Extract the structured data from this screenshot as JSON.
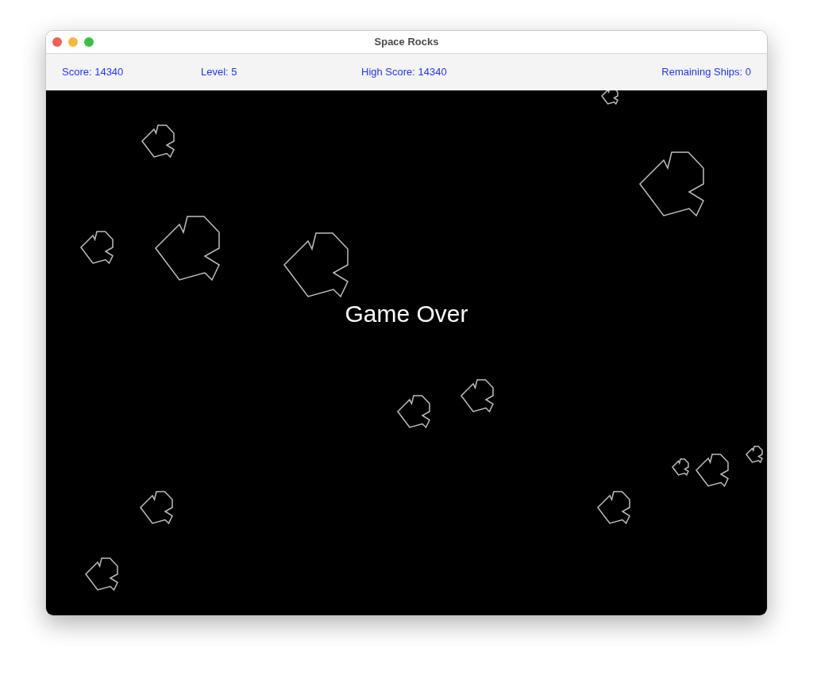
{
  "window": {
    "title": "Space Rocks"
  },
  "stats": [
    {
      "text": "Score: 14340"
    },
    {
      "text": "Level: 5"
    },
    {
      "text": "High Score: 14340"
    },
    {
      "text": "Remaining Ships: 0"
    }
  ],
  "message": "Game Over"
}
